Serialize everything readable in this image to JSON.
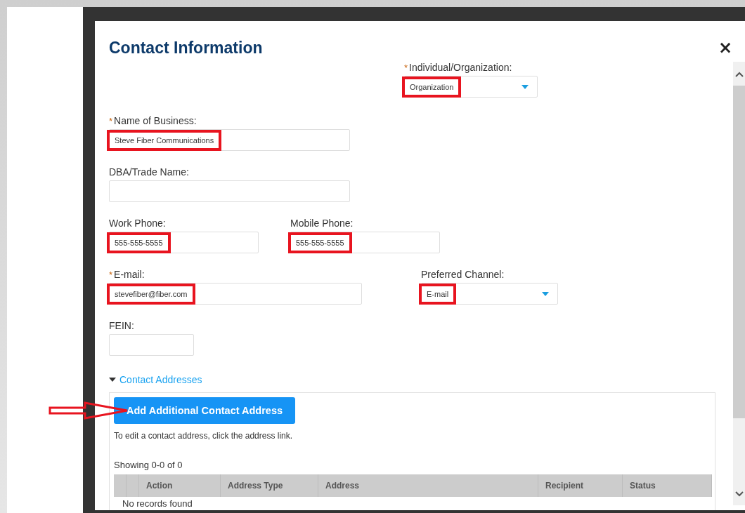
{
  "dialog": {
    "title": "Contact Information",
    "close": "×",
    "rows": [
      [
        {
          "label": "Individual/Organization:",
          "required": "*",
          "kind": "select",
          "value": "Organization",
          "highlighted": true
        }
      ],
      [
        {
          "label": "Name of Business:",
          "required": "*",
          "kind": "text",
          "value": "Steve Fiber Communications",
          "highlighted": true
        }
      ],
      [
        {
          "label": "DBA/Trade Name:",
          "kind": "text",
          "highlighted": false
        }
      ],
      [
        {
          "label": "Work Phone:",
          "kind": "text",
          "value": "555-555-5555",
          "highlighted": true
        },
        {
          "label": "Mobile Phone:",
          "kind": "text",
          "value": "555-555-5555",
          "highlighted": true
        }
      ],
      [
        {
          "label": "E-mail:",
          "required": "*",
          "kind": "text",
          "value": "stevefiber@fiber.com",
          "highlighted": true
        },
        {
          "label": "Preferred Channel:",
          "kind": "select",
          "value": "E-mail",
          "highlighted": true
        }
      ],
      [
        {
          "label": "FEIN:",
          "kind": "text",
          "highlighted": false
        }
      ]
    ],
    "addresses": {
      "label": "Contact Addresses",
      "expanded": true,
      "button": {
        "label": "Add Additional Contact Address",
        "pointed_at": true
      },
      "hint": "To edit a contact address, click the address link.",
      "count": "Showing 0-0 of 0",
      "columns": [
        "Action",
        "Address Type",
        "Address",
        "Recipient",
        "Status"
      ],
      "empty_message": "No records found"
    }
  }
}
